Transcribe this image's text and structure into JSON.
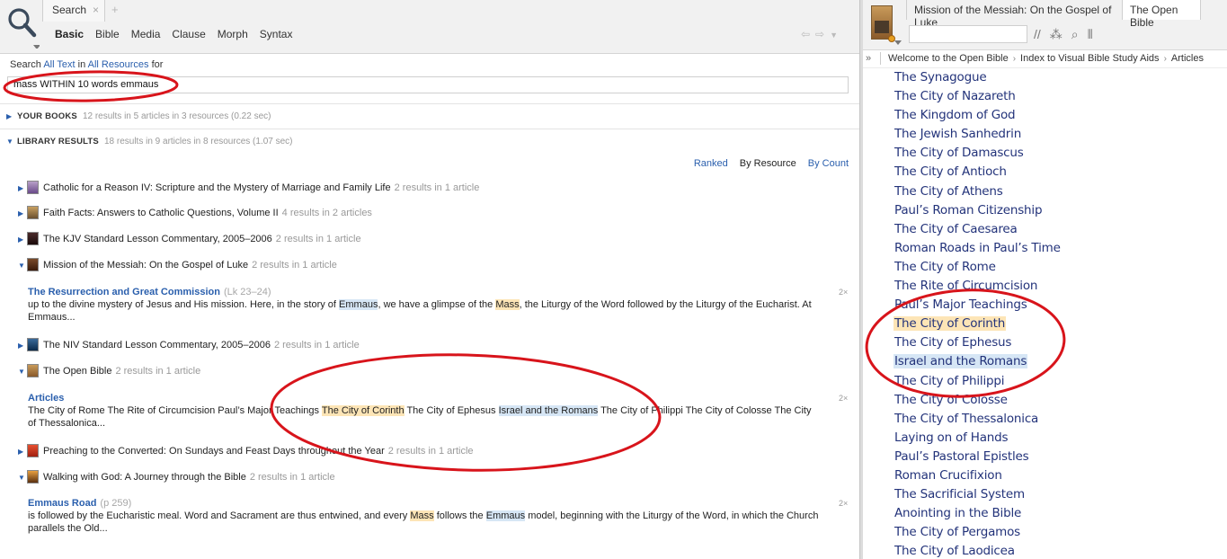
{
  "left": {
    "tab_label": "Search",
    "tab_close": "×",
    "tab_add": "+",
    "subtabs": [
      "Basic",
      "Bible",
      "Media",
      "Clause",
      "Morph",
      "Syntax"
    ],
    "search_prefix": "Search",
    "search_all_text": "All Text",
    "search_in": "in",
    "search_all_resources": "All Resources",
    "search_for": "for",
    "query": "mass WITHIN 10 words emmaus",
    "your_books": {
      "title": "YOUR BOOKS",
      "info": "12 results in 5 articles in 3 resources (0.22 sec)"
    },
    "library": {
      "title": "LIBRARY RESULTS",
      "info": "18 results in 9 articles in 8 resources (1.07 sec)"
    },
    "sort": {
      "ranked": "Ranked",
      "by_resource": "By Resource",
      "by_count": "By Count"
    },
    "results": [
      {
        "title": "Catholic for a Reason IV: Scripture and the Mystery of Marriage and Family Life",
        "count": "2 results in 1 article"
      },
      {
        "title": "Faith Facts: Answers to Catholic Questions, Volume II",
        "count": "4 results in 2 articles"
      },
      {
        "title": "The KJV Standard Lesson Commentary, 2005–2006",
        "count": "2 results in 1 article"
      },
      {
        "title": "Mission of the Messiah: On the Gospel of Luke",
        "count": "2 results in 1 article"
      },
      {
        "title": "The NIV Standard Lesson Commentary, 2005–2006",
        "count": "2 results in 1 article"
      },
      {
        "title": "The Open Bible",
        "count": "2 results in 1 article"
      },
      {
        "title": "Preaching to the Converted: On Sundays and Feast Days throughout the Year",
        "count": "2 results in 1 article"
      },
      {
        "title": "Walking with God: A Journey through the Bible",
        "count": "2 results in 1 article"
      }
    ],
    "articles": [
      {
        "title": "The Resurrection and Great Commission",
        "ref": "(Lk 23–24)",
        "count": "2×",
        "s1": "up to the divine mystery of Jesus and His mission. Here, in the story of ",
        "h1": "Emmaus",
        "s2": ", we have a glimpse of the ",
        "h2": "Mass",
        "s3": ", the Liturgy of the Word followed by the Liturgy of the Eucharist. At Emmaus..."
      },
      {
        "title": "Articles",
        "ref": "",
        "count": "2×",
        "s1": "The City of Rome The Rite of Circumcision Paul’s Major Teachings ",
        "h1": "The City of Corinth",
        "s2": " The City of Ephesus ",
        "h2": "Israel and the Romans",
        "s3": " The City of Philippi The City of Colosse The City of Thessalonica..."
      },
      {
        "title": "Emmaus Road",
        "ref": "(p 259)",
        "count": "2×",
        "s1": "is followed by the Eucharistic meal. Word and Sacrament are thus entwined, and every ",
        "h1": "Mass",
        "s2": " follows the ",
        "h2": "Emmaus",
        "s3": " model, beginning with the Liturgy of the Word, in which the Church parallels the Old..."
      }
    ]
  },
  "right": {
    "tab1": "Mission of the Messiah: On the Gospel of Luke",
    "tab2": "The Open Bible",
    "breadcrumb": [
      "Welcome to the Open Bible",
      "Index to Visual Bible Study Aids",
      "Articles"
    ],
    "breadcrumb_expand": "»",
    "toc": [
      "The Synagogue",
      "The City of Nazareth",
      "The Kingdom of God",
      "The Jewish Sanhedrin",
      "The City of Damascus",
      "The City of Antioch",
      "The City of Athens",
      "Paul’s Roman Citizenship",
      "The City of Caesarea",
      "Roman Roads in Paul’s Time",
      "The City of Rome",
      "The Rite of Circumcision",
      "Paul’s Major Teachings",
      "The City of Corinth",
      "The City of Ephesus",
      "Israel and the Romans",
      "The City of Philippi",
      "The City of Colosse",
      "The City of Thessalonica",
      "Laying on of Hands",
      "Paul’s Pastoral Epistles",
      "Roman Crucifixion",
      "The Sacrificial System",
      "Anointing in the Bible",
      "The City of Pergamos",
      "The City of Laodicea"
    ]
  },
  "colors": {
    "link": "#2a5fad",
    "highlight_yellow": "#fde5b6",
    "highlight_blue": "#d6e6f5",
    "annotation_red": "#d8141b"
  }
}
